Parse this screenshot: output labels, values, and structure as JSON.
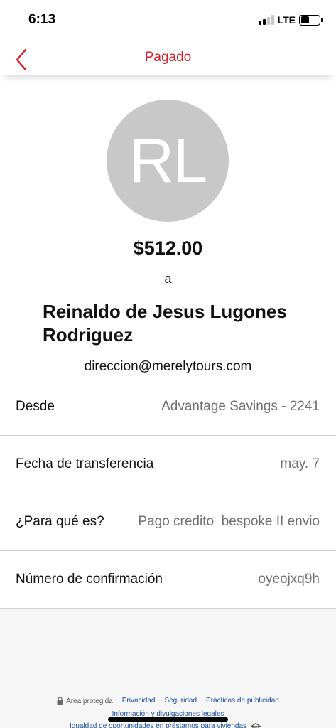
{
  "status_bar": {
    "time": "6:13",
    "network": "LTE",
    "battery_level": 0.45
  },
  "nav": {
    "title": "Pagado",
    "accent_color": "#d71e28"
  },
  "recipient": {
    "initials": "RL",
    "amount": "$512.00",
    "to_label": "a",
    "name": "Reinaldo de Jesus Lugones Rodriguez",
    "email": "direccion@merelytours.com"
  },
  "details": [
    {
      "label": "Desde",
      "value": "Advantage Savings - 2241"
    },
    {
      "label": "Fecha de transferencia",
      "value": "may. 7"
    },
    {
      "label": "¿Para qué es?",
      "value": "Pago credito  bespoke II envio"
    },
    {
      "label": "Número de confirmación",
      "value": "oyeojxq9h"
    }
  ],
  "footer": {
    "secure_area": "Área protegida",
    "links": [
      "Privacidad",
      "Seguridad",
      "Prácticas de publicidad"
    ],
    "legal": "Información y divulgaciones legales",
    "housing": "Igualdad de oportunidades en préstamos para viviendas"
  }
}
